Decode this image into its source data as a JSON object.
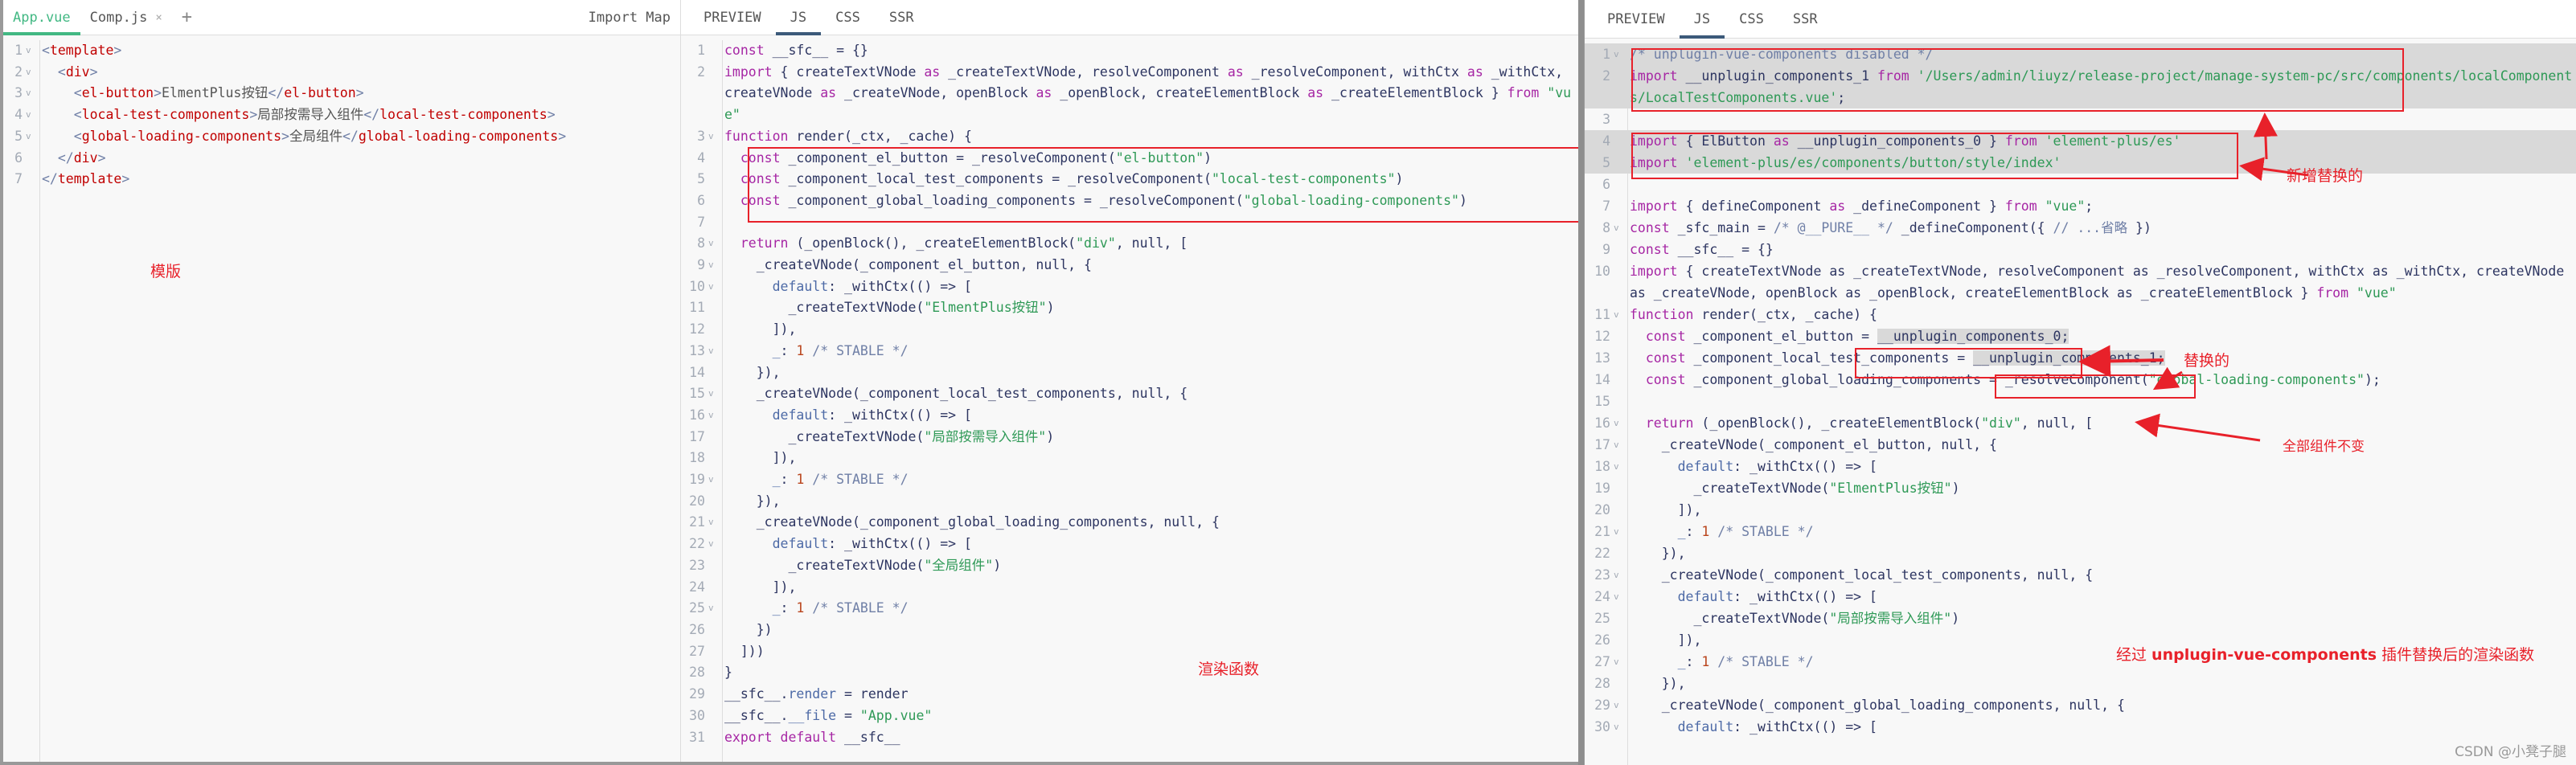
{
  "editor": {
    "tabs": [
      {
        "label": "App.vue",
        "active": true
      },
      {
        "label": "Comp.js",
        "closable": true
      }
    ],
    "add_tab_label": "+",
    "close_glyph": "×",
    "import_map_label": "Import Map",
    "lines": [
      {
        "n": "1",
        "fold": true,
        "html": "<span class='bracket'>&lt;</span><span class='tag'>template</span><span class='bracket'>&gt;</span>"
      },
      {
        "n": "2",
        "fold": true,
        "html": "  <span class='bracket'>&lt;</span><span class='tag'>div</span><span class='bracket'>&gt;</span>"
      },
      {
        "n": "3",
        "fold": true,
        "html": "    <span class='bracket'>&lt;</span><span class='tag'>el-button</span><span class='bracket'>&gt;</span><span class='p'>ElmentPlus按钮</span><span class='bracket'>&lt;/</span><span class='tag'>el-button</span><span class='bracket'>&gt;</span>"
      },
      {
        "n": "4",
        "fold": true,
        "html": "    <span class='bracket'>&lt;</span><span class='tag'>local-test-components</span><span class='bracket'>&gt;</span><span class='p'>局部按需导入组件</span><span class='bracket'>&lt;/</span><span class='tag'>local-test-components</span><span class='bracket'>&gt;</span>"
      },
      {
        "n": "5",
        "fold": true,
        "html": "    <span class='bracket'>&lt;</span><span class='tag'>global-loading-components</span><span class='bracket'>&gt;</span><span class='p'>全局组件</span><span class='bracket'>&lt;/</span><span class='tag'>global-loading-components</span><span class='bracket'>&gt;</span>"
      },
      {
        "n": "6",
        "fold": false,
        "html": "  <span class='bracket'>&lt;/</span><span class='tag'>div</span><span class='bracket'>&gt;</span>"
      },
      {
        "n": "7",
        "fold": false,
        "html": "<span class='bracket'>&lt;/</span><span class='tag'>template</span><span class='bracket'>&gt;</span>"
      }
    ],
    "annotation": "模版"
  },
  "output_a": {
    "tabs": [
      {
        "label": "PREVIEW"
      },
      {
        "label": "JS",
        "active": true
      },
      {
        "label": "CSS"
      },
      {
        "label": "SSR"
      }
    ],
    "lines": [
      {
        "n": "1",
        "fold": false,
        "html": "<span class='k'>const</span> __sfc__ = {}"
      },
      {
        "n": "2",
        "fold": false,
        "html": "<span class='k'>import</span> { createTextVNode <span class='k'>as</span> _createTextVNode, resolveComponent <span class='k'>as</span> _resolveComponent, withCtx <span class='k'>as</span> _withCtx, createVNode <span class='k'>as</span> _createVNode, openBlock <span class='k'>as</span> _openBlock, createElementBlock <span class='k'>as</span> _createElementBlock } <span class='k'>from</span> <span class='s'>\"vue\"</span>"
      },
      {
        "n": "3",
        "fold": true,
        "html": "<span class='k'>function</span> render(_ctx, _cache) {"
      },
      {
        "n": "4",
        "fold": false,
        "html": "  <span class='k'>const</span> _component_el_button = _resolveComponent(<span class='s'>\"el-button\"</span>)"
      },
      {
        "n": "5",
        "fold": false,
        "html": "  <span class='k'>const</span> _component_local_test_components = _resolveComponent(<span class='s'>\"local-test-components\"</span>)"
      },
      {
        "n": "6",
        "fold": false,
        "html": "  <span class='k'>const</span> _component_global_loading_components = _resolveComponent(<span class='s'>\"global-loading-components\"</span>)"
      },
      {
        "n": "7",
        "fold": false,
        "html": ""
      },
      {
        "n": "8",
        "fold": true,
        "html": "  <span class='k'>return</span> (_openBlock(), _createElementBlock(<span class='s'>\"div\"</span>, null, ["
      },
      {
        "n": "9",
        "fold": true,
        "html": "    _createVNode(_component_el_button, null, {"
      },
      {
        "n": "10",
        "fold": true,
        "html": "      <span class='prop'>default</span>: _withCtx(() =&gt; ["
      },
      {
        "n": "11",
        "fold": false,
        "html": "        _createTextVNode(<span class='s'>\"ElmentPlus按钮\"</span>)"
      },
      {
        "n": "12",
        "fold": false,
        "html": "      ]),"
      },
      {
        "n": "13",
        "fold": true,
        "html": "      <span class='prop'>_</span>: <span class='n'>1</span> <span class='c'>/* STABLE */</span>"
      },
      {
        "n": "14",
        "fold": false,
        "html": "    }),"
      },
      {
        "n": "15",
        "fold": true,
        "html": "    _createVNode(_component_local_test_components, null, {"
      },
      {
        "n": "16",
        "fold": true,
        "html": "      <span class='prop'>default</span>: _withCtx(() =&gt; ["
      },
      {
        "n": "17",
        "fold": false,
        "html": "        _createTextVNode(<span class='s'>\"局部按需导入组件\"</span>)"
      },
      {
        "n": "18",
        "fold": false,
        "html": "      ]),"
      },
      {
        "n": "19",
        "fold": true,
        "html": "      <span class='prop'>_</span>: <span class='n'>1</span> <span class='c'>/* STABLE */</span>"
      },
      {
        "n": "20",
        "fold": false,
        "html": "    }),"
      },
      {
        "n": "21",
        "fold": true,
        "html": "    _createVNode(_component_global_loading_components, null, {"
      },
      {
        "n": "22",
        "fold": true,
        "html": "      <span class='prop'>default</span>: _withCtx(() =&gt; ["
      },
      {
        "n": "23",
        "fold": false,
        "html": "        _createTextVNode(<span class='s'>\"全局组件\"</span>)"
      },
      {
        "n": "24",
        "fold": false,
        "html": "      ]),"
      },
      {
        "n": "25",
        "fold": true,
        "html": "      <span class='prop'>_</span>: <span class='n'>1</span> <span class='c'>/* STABLE */</span>"
      },
      {
        "n": "26",
        "fold": false,
        "html": "    })"
      },
      {
        "n": "27",
        "fold": false,
        "html": "  ]))"
      },
      {
        "n": "28",
        "fold": false,
        "html": "}"
      },
      {
        "n": "29",
        "fold": false,
        "html": "__sfc__.<span class='prop'>render</span> = render"
      },
      {
        "n": "30",
        "fold": false,
        "html": "__sfc__.<span class='prop'>__file</span> = <span class='s'>\"App.vue\"</span>"
      },
      {
        "n": "31",
        "fold": false,
        "html": "<span class='k'>export</span> <span class='k'>default</span> __sfc__"
      }
    ],
    "annotation": "渲染函数"
  },
  "output_b": {
    "tabs": [
      {
        "label": "PREVIEW"
      },
      {
        "label": "JS",
        "active": true
      },
      {
        "label": "CSS"
      },
      {
        "label": "SSR"
      }
    ],
    "lines": [
      {
        "n": "1",
        "fold": true,
        "hl": true,
        "html": "<span class='c'>/* unplugin-vue-components disabled */</span>"
      },
      {
        "n": "2",
        "fold": false,
        "hl": true,
        "html": "<span class='k'>import</span> __unplugin_components_1 <span class='k'>from</span> <span class='s'>'/Users/admin/liuyz/release-project/manage-system-pc/src/components/localComponents/LocalTestComponents.vue'</span>;"
      },
      {
        "n": "3",
        "fold": false,
        "html": ""
      },
      {
        "n": "4",
        "fold": false,
        "hl": true,
        "html": "<span class='k'>import</span> { ElButton <span class='k'>as</span> __unplugin_components_0 } <span class='k'>from</span> <span class='s'>'element-plus/es'</span>"
      },
      {
        "n": "5",
        "fold": false,
        "hl": true,
        "html": "<span class='k'>import</span> <span class='s'>'element-plus/es/components/button/style/index'</span>"
      },
      {
        "n": "6",
        "fold": false,
        "html": ""
      },
      {
        "n": "7",
        "fold": false,
        "html": "<span class='k'>import</span> { defineComponent <span class='k'>as</span> _defineComponent } <span class='k'>from</span> <span class='s'>\"vue\"</span>;"
      },
      {
        "n": "8",
        "fold": true,
        "html": "<span class='k'>const</span> _sfc_main = <span class='c'>/* @__PURE__ */</span> _defineComponent({ <span class='c'>// ...省略</span> })"
      },
      {
        "n": "9",
        "fold": false,
        "html": "<span class='k'>const</span> __sfc__ = {}"
      },
      {
        "n": "10",
        "fold": false,
        "html": "<span class='k'>import</span> { createTextVNode as _createTextVNode, resolveComponent as _resolveComponent, withCtx as _withCtx, createVNode as _createVNode, openBlock as _openBlock, createElementBlock as _createElementBlock } <span class='k'>from</span> <span class='s'>\"vue\"</span>"
      },
      {
        "n": "11",
        "fold": true,
        "html": "<span class='k'>function</span> render(_ctx, _cache) {"
      },
      {
        "n": "12",
        "fold": false,
        "html": "  <span class='k'>const</span> _component_el_button = <span class='hl'>__unplugin_components_0;</span>"
      },
      {
        "n": "13",
        "fold": false,
        "html": "  <span class='k'>const</span> _component_local_test_components = <span class='hl'>__unplugin_components_1;</span>"
      },
      {
        "n": "14",
        "fold": false,
        "html": "  <span class='k'>const</span> _component_global_loading_components = _resolveComponent(<span class='s'>\"global-loading-components\"</span>);"
      },
      {
        "n": "15",
        "fold": false,
        "html": ""
      },
      {
        "n": "16",
        "fold": true,
        "html": "  <span class='k'>return</span> (_openBlock(), _createElementBlock(<span class='s'>\"div\"</span>, null, ["
      },
      {
        "n": "17",
        "fold": true,
        "html": "    _createVNode(_component_el_button, null, {"
      },
      {
        "n": "18",
        "fold": true,
        "html": "      <span class='prop'>default</span>: _withCtx(() =&gt; ["
      },
      {
        "n": "19",
        "fold": false,
        "html": "        _createTextVNode(<span class='s'>\"ElmentPlus按钮\"</span>)"
      },
      {
        "n": "20",
        "fold": false,
        "html": "      ]),"
      },
      {
        "n": "21",
        "fold": true,
        "html": "      <span class='prop'>_</span>: <span class='n'>1</span> <span class='c'>/* STABLE */</span>"
      },
      {
        "n": "22",
        "fold": false,
        "html": "    }),"
      },
      {
        "n": "23",
        "fold": true,
        "html": "    _createVNode(_component_local_test_components, null, {"
      },
      {
        "n": "24",
        "fold": true,
        "html": "      <span class='prop'>default</span>: _withCtx(() =&gt; ["
      },
      {
        "n": "25",
        "fold": false,
        "html": "        _createTextVNode(<span class='s'>\"局部按需导入组件\"</span>)"
      },
      {
        "n": "26",
        "fold": false,
        "html": "      ]),"
      },
      {
        "n": "27",
        "fold": true,
        "html": "      <span class='prop'>_</span>: <span class='n'>1</span> <span class='c'>/* STABLE */</span>"
      },
      {
        "n": "28",
        "fold": false,
        "html": "    }),"
      },
      {
        "n": "29",
        "fold": true,
        "html": "    _createVNode(_component_global_loading_components, null, {"
      },
      {
        "n": "30",
        "fold": true,
        "html": "      <span class='prop'>default</span>: _withCtx(() =&gt; ["
      }
    ],
    "annotations": {
      "added": "新增替换的",
      "replaced": "替换的",
      "unchanged": "全部组件不变",
      "summary_prefix": "经过 ",
      "summary_bold": "unplugin-vue-components",
      "summary_suffix": " 插件替换后的渲染函数"
    },
    "watermark": "CSDN @小凳子腿"
  },
  "colors": {
    "annotation": "#e8212a",
    "keyword": "#a626a4",
    "string": "#2e9956",
    "number": "#b9451d",
    "comment": "#6f7fa6",
    "vue_green": "#42b883",
    "tab_active_blue": "#3c5a7a",
    "highlight": "#d9d9d9"
  },
  "fold_glyph": "v"
}
